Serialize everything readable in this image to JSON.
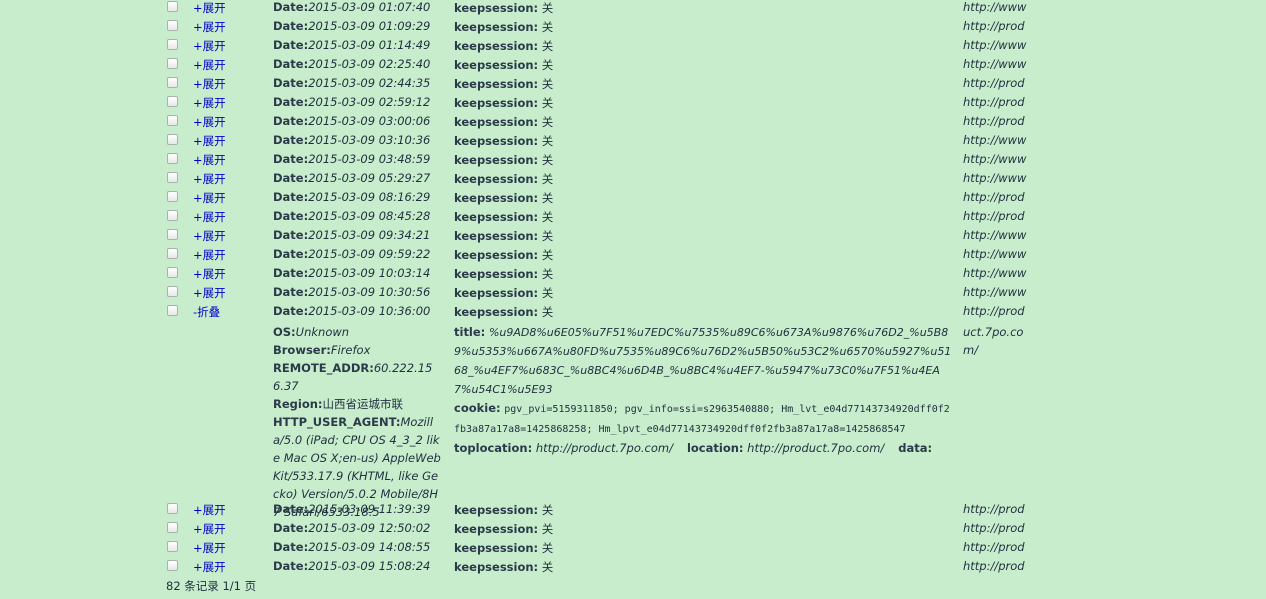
{
  "rows_before": [
    {
      "toggle": "+展开",
      "date_label": "Date:",
      "date": "2015-03-09 01:07:40",
      "keep_label": "keepsession:",
      "keep": "关",
      "url": "http://www"
    },
    {
      "toggle": "+展开",
      "date_label": "Date:",
      "date": "2015-03-09 01:09:29",
      "keep_label": "keepsession:",
      "keep": "关",
      "url": "http://prod"
    },
    {
      "toggle": "+展开",
      "date_label": "Date:",
      "date": "2015-03-09 01:14:49",
      "keep_label": "keepsession:",
      "keep": "关",
      "url": "http://www"
    },
    {
      "toggle": "+展开",
      "date_label": "Date:",
      "date": "2015-03-09 02:25:40",
      "keep_label": "keepsession:",
      "keep": "关",
      "url": "http://www"
    },
    {
      "toggle": "+展开",
      "date_label": "Date:",
      "date": "2015-03-09 02:44:35",
      "keep_label": "keepsession:",
      "keep": "关",
      "url": "http://prod"
    },
    {
      "toggle": "+展开",
      "date_label": "Date:",
      "date": "2015-03-09 02:59:12",
      "keep_label": "keepsession:",
      "keep": "关",
      "url": "http://prod"
    },
    {
      "toggle": "+展开",
      "date_label": "Date:",
      "date": "2015-03-09 03:00:06",
      "keep_label": "keepsession:",
      "keep": "关",
      "url": "http://prod"
    },
    {
      "toggle": "+展开",
      "date_label": "Date:",
      "date": "2015-03-09 03:10:36",
      "keep_label": "keepsession:",
      "keep": "关",
      "url": "http://www"
    },
    {
      "toggle": "+展开",
      "date_label": "Date:",
      "date": "2015-03-09 03:48:59",
      "keep_label": "keepsession:",
      "keep": "关",
      "url": "http://www"
    },
    {
      "toggle": "+展开",
      "date_label": "Date:",
      "date": "2015-03-09 05:29:27",
      "keep_label": "keepsession:",
      "keep": "关",
      "url": "http://www"
    },
    {
      "toggle": "+展开",
      "date_label": "Date:",
      "date": "2015-03-09 08:16:29",
      "keep_label": "keepsession:",
      "keep": "关",
      "url": "http://prod"
    },
    {
      "toggle": "+展开",
      "date_label": "Date:",
      "date": "2015-03-09 08:45:28",
      "keep_label": "keepsession:",
      "keep": "关",
      "url": "http://prod"
    },
    {
      "toggle": "+展开",
      "date_label": "Date:",
      "date": "2015-03-09 09:34:21",
      "keep_label": "keepsession:",
      "keep": "关",
      "url": "http://www"
    },
    {
      "toggle": "+展开",
      "date_label": "Date:",
      "date": "2015-03-09 09:59:22",
      "keep_label": "keepsession:",
      "keep": "关",
      "url": "http://www"
    },
    {
      "toggle": "+展开",
      "date_label": "Date:",
      "date": "2015-03-09 10:03:14",
      "keep_label": "keepsession:",
      "keep": "关",
      "url": "http://www"
    },
    {
      "toggle": "+展开",
      "date_label": "Date:",
      "date": "2015-03-09 10:30:56",
      "keep_label": "keepsession:",
      "keep": "关",
      "url": "http://www"
    }
  ],
  "expanded_row": {
    "toggle": "-折叠",
    "date_label": "Date:",
    "date": "2015-03-09 10:36:00",
    "keep_label": "keepsession:",
    "keep": "关",
    "url": "http://prod",
    "url_rest": "uct.7po.com/",
    "os_label": "OS:",
    "os": "Unknown",
    "browser_label": "Browser:",
    "browser": "Firefox",
    "addr_label": "REMOTE_ADDR:",
    "addr": "60.222.156.37",
    "region_label": "Region:",
    "region": "山西省运城市联",
    "ua_label": "HTTP_USER_AGENT:",
    "ua": "Mozilla/5.0 (iPad; CPU OS 4_3_2 like Mac OS X;en-us) AppleWebKit/533.17.9 (KHTML, like Gecko) Version/5.0.2 Mobile/8H7 Safari/6533.18.5",
    "title_label": "title:",
    "title": "%u9AD8%u6E05%u7F51%u7EDC%u7535%u89C6%u673A%u9876%u76D2_%u5B89%u5353%u667A%u80FD%u7535%u89C6%u76D2%u5B50%u53C2%u6570%u5927%u5168_%u4EF7%u683C_%u8BC4%u6D4B_%u8BC4%u4EF7-%u5947%u73C0%u7F51%u4EA7%u54C1%u5E93",
    "cookie_label": "cookie:",
    "cookie": "pgv_pvi=5159311850; pgv_info=ssi=s2963540880; Hm_lvt_e04d77143734920dff0f2fb3a87a17a8=1425868258; Hm_lpvt_e04d77143734920dff0f2fb3a87a17a8=1425868547",
    "toplocation_label": "toplocation:",
    "toplocation": "http://product.7po.com/",
    "location_label": "location:",
    "location": "http://product.7po.com/",
    "data_label": "data:"
  },
  "rows_after": [
    {
      "toggle": "+展开",
      "date_label": "Date:",
      "date": "2015-03-09 11:39:39",
      "keep_label": "keepsession:",
      "keep": "关",
      "url": "http://prod"
    },
    {
      "toggle": "+展开",
      "date_label": "Date:",
      "date": "2015-03-09 12:50:02",
      "keep_label": "keepsession:",
      "keep": "关",
      "url": "http://prod"
    },
    {
      "toggle": "+展开",
      "date_label": "Date:",
      "date": "2015-03-09 14:08:55",
      "keep_label": "keepsession:",
      "keep": "关",
      "url": "http://prod"
    },
    {
      "toggle": "+展开",
      "date_label": "Date:",
      "date": "2015-03-09 15:08:24",
      "keep_label": "keepsession:",
      "keep": "关",
      "url": "http://prod"
    }
  ],
  "footer": {
    "text": "82 条记录 1/1 页"
  }
}
